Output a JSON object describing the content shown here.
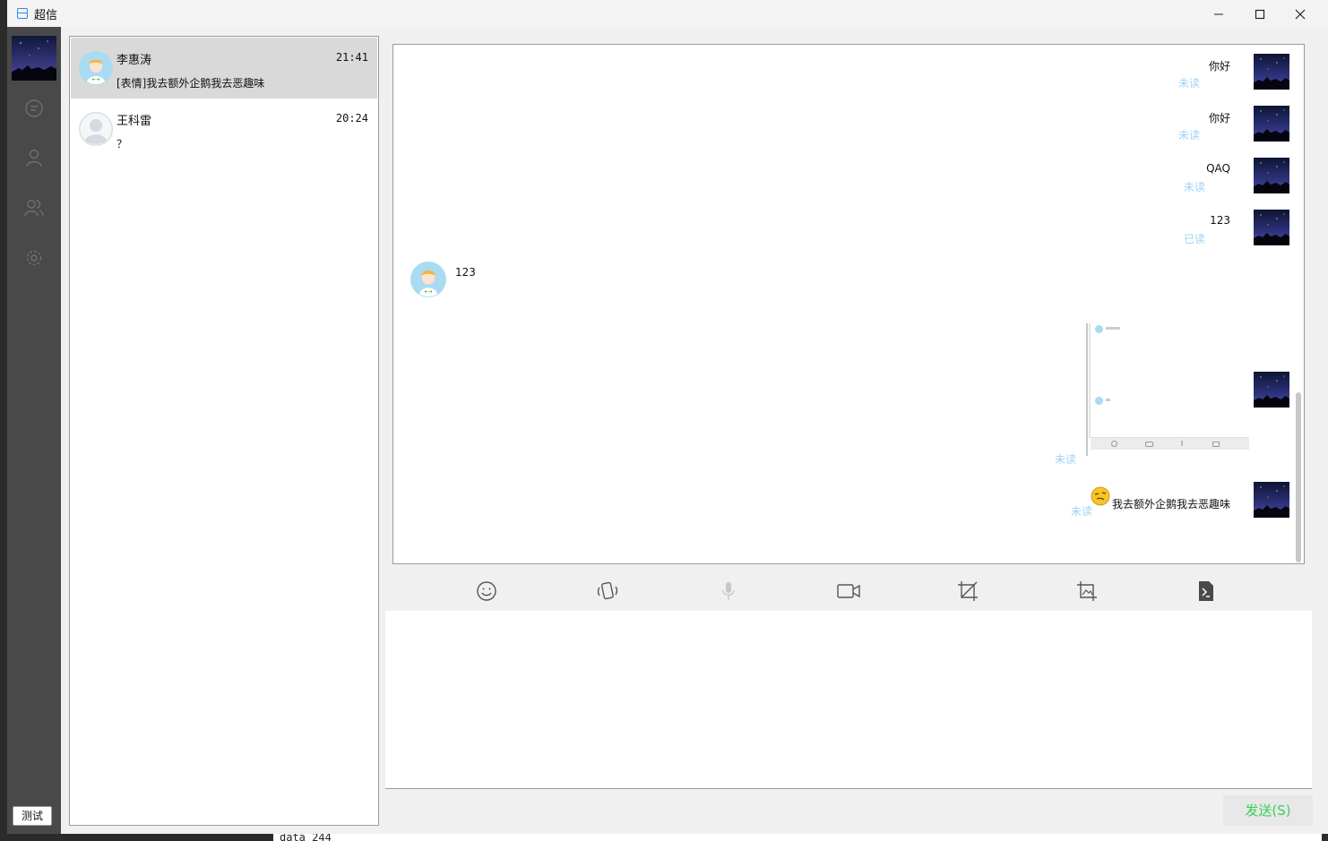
{
  "window": {
    "title": "超信"
  },
  "sidebar": {
    "test_button": "测试"
  },
  "chat_list": [
    {
      "name": "李惠涛",
      "time": "21:41",
      "last_message": "[表情]我去额外企鹅我去恶趣味"
    },
    {
      "name": "王科雷",
      "time": "20:24",
      "last_message": "？"
    }
  ],
  "messages": [
    {
      "text": "你好",
      "status": "未读"
    },
    {
      "text": "你好",
      "status": "未读"
    },
    {
      "text": "QAQ",
      "status": "未读"
    },
    {
      "text": "123",
      "status": "已读"
    },
    {
      "text": "123"
    },
    {
      "status": "未读"
    },
    {
      "text": "我去额外企鹅我去恶趣味",
      "status": "未读"
    }
  ],
  "send_button": "发送(S)",
  "background_text": "data 244",
  "colors": {
    "sidebar": "#494949",
    "status": "#9fd3f4",
    "send": "#3ccf5b",
    "active_item": "#d9d9d9"
  }
}
